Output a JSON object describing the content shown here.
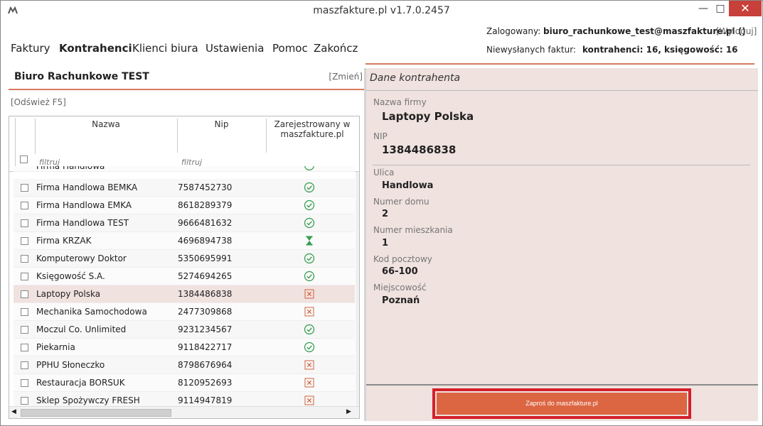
{
  "window": {
    "title": "maszfakture.pl  v1.7.0.2457",
    "minimize": "—",
    "maximize": "□",
    "close": "✕"
  },
  "menu": {
    "items": [
      "Faktury",
      "Kontrahenci",
      "Klienci biura",
      "Ustawienia",
      "Pomoc",
      "Zakończ"
    ],
    "active": "Kontrahenci"
  },
  "header": {
    "logged_label": "Zalogowany:",
    "logged_user": "biuro_rachunkowe_test@maszfakture.pl ()",
    "logout": "[Wyloguj]",
    "unsent_label": "Niewysłanych faktur:",
    "unsent_value": "kontrahenci: 16, księgowość: 16"
  },
  "office": {
    "name": "Biuro Rachunkowe TEST",
    "change": "[Zmień]",
    "refresh": "[Odśwież F5]"
  },
  "grid": {
    "columns": {
      "name": "Nazwa",
      "nip": "Nip",
      "registered_line1": "Zarejestrowany w",
      "registered_line2": "maszfakture.pl"
    },
    "filter_placeholder": "filtruj",
    "partial_row": "Firma Handlowa",
    "rows": [
      {
        "name": "Firma Handlowa BEMKA",
        "nip": "7587452730",
        "status": "registered"
      },
      {
        "name": "Firma Handlowa EMKA",
        "nip": "8618289379",
        "status": "registered"
      },
      {
        "name": "Firma Handlowa TEST",
        "nip": "9666481632",
        "status": "registered"
      },
      {
        "name": "Firma KRZAK",
        "nip": "4696894738",
        "status": "pending"
      },
      {
        "name": "Komputerowy Doktor",
        "nip": "5350695991",
        "status": "registered"
      },
      {
        "name": "Księgowość S.A.",
        "nip": "5274694265",
        "status": "registered"
      },
      {
        "name": "Laptopy Polska",
        "nip": "1384486838",
        "status": "not_registered",
        "selected": true
      },
      {
        "name": "Mechanika Samochodowa",
        "nip": "2477309868",
        "status": "not_registered"
      },
      {
        "name": "Moczul Co. Unlimited",
        "nip": "9231234567",
        "status": "registered"
      },
      {
        "name": "Piekarnia",
        "nip": "9118422717",
        "status": "registered"
      },
      {
        "name": "PPHU Słoneczko",
        "nip": "8798676964",
        "status": "not_registered"
      },
      {
        "name": "Restauracja BORSUK",
        "nip": "8120952693",
        "status": "not_registered"
      },
      {
        "name": "Sklep Spożywczy FRESH",
        "nip": "9114947819",
        "status": "not_registered"
      }
    ],
    "status_colors": {
      "registered": "#2e9a4a",
      "pending": "#2e9a4a",
      "not_registered": "#d2603c"
    }
  },
  "details": {
    "title": "Dane kontrahenta",
    "fields": {
      "company_label": "Nazwa firmy",
      "company_value": "Laptopy Polska",
      "nip_label": "NIP",
      "nip_value": "1384486838",
      "street_label": "Ulica",
      "street_value": "Handlowa",
      "house_label": "Numer domu",
      "house_value": "2",
      "flat_label": "Numer mieszkania",
      "flat_value": "1",
      "postal_label": "Kod pocztowy",
      "postal_value": "66-100",
      "city_label": "Miejscowość",
      "city_value": "Poznań"
    },
    "invite_button": "Zaproś do maszfakture.pl"
  }
}
